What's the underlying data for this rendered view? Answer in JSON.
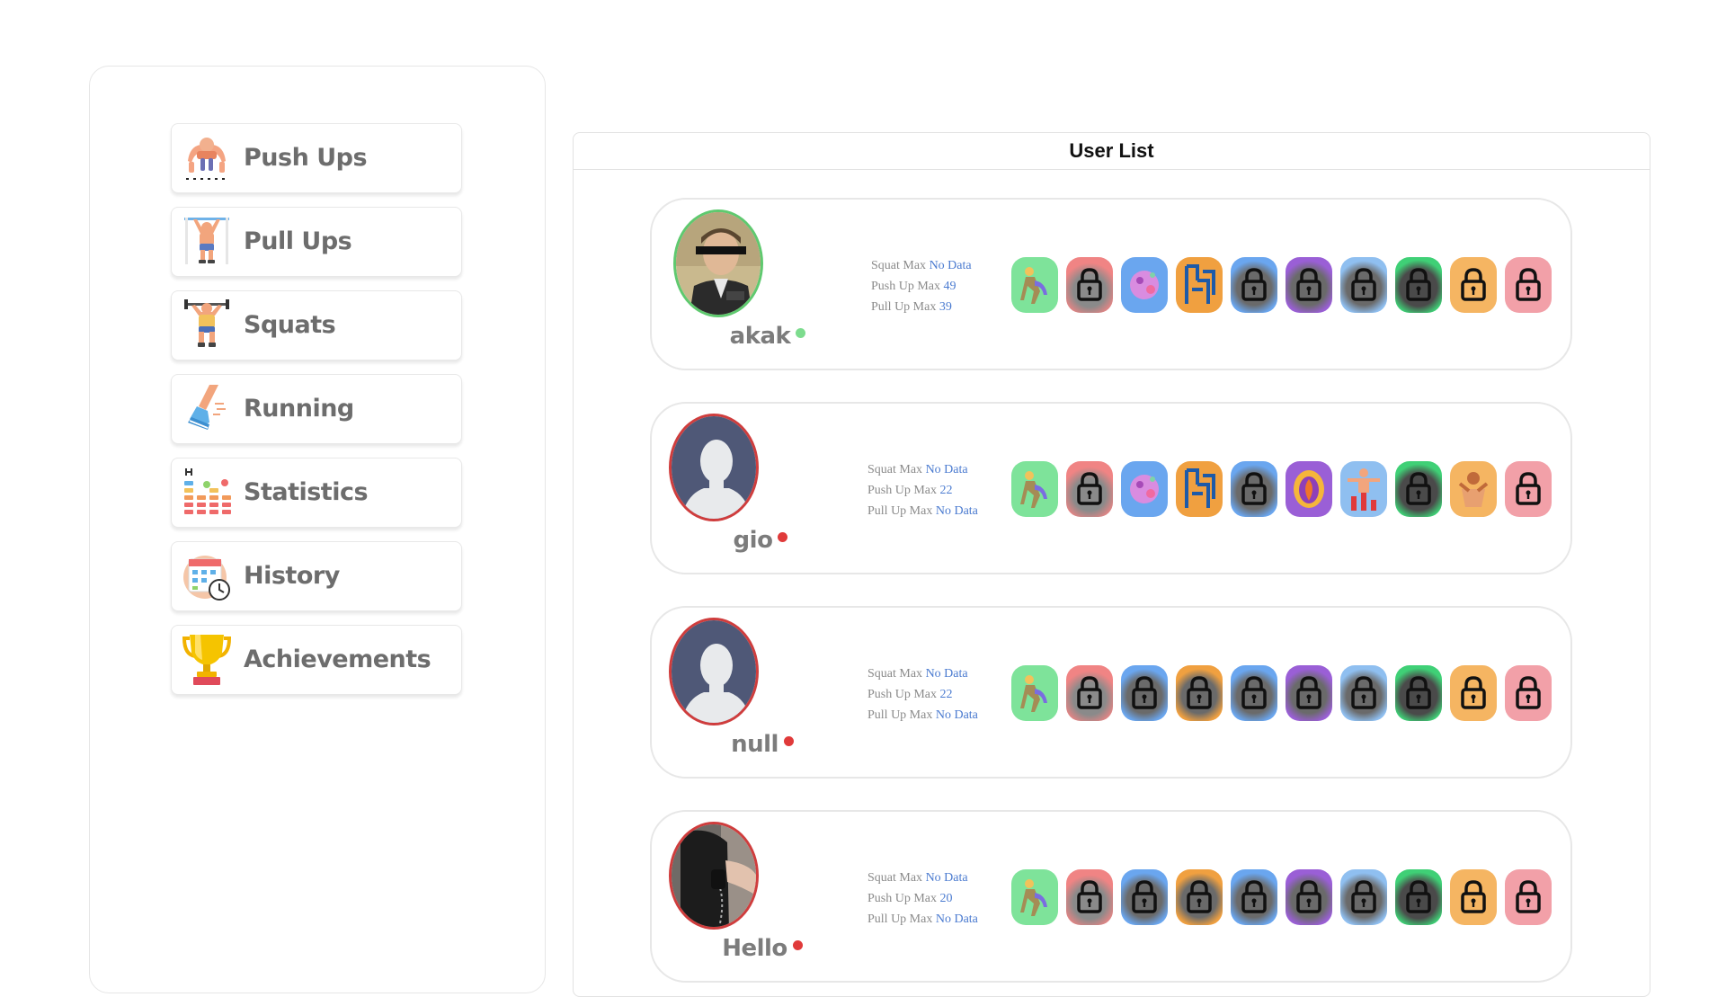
{
  "nav": {
    "items": [
      {
        "label": "Push Ups",
        "icon": "push-ups-icon"
      },
      {
        "label": "Pull Ups",
        "icon": "pull-ups-icon"
      },
      {
        "label": "Squats",
        "icon": "squats-icon"
      },
      {
        "label": "Running",
        "icon": "running-icon"
      },
      {
        "label": "Statistics",
        "icon": "statistics-icon"
      },
      {
        "label": "History",
        "icon": "history-icon"
      },
      {
        "label": "Achievements",
        "icon": "achievements-icon"
      }
    ]
  },
  "user_list": {
    "title": "User List",
    "stat_labels": {
      "squat": "Squat Max",
      "push": "Push Up Max",
      "pull": "Pull Up Max"
    },
    "users": [
      {
        "name": "akak",
        "status": "online",
        "avatar": "photo-portrait-avatar",
        "squat_max": "No Data",
        "push_max": "49",
        "pull_max": "39",
        "badges": [
          "unlocked",
          "locked",
          "unlocked",
          "unlocked",
          "locked",
          "locked",
          "locked",
          "locked",
          "locked",
          "locked"
        ]
      },
      {
        "name": "gio",
        "status": "offline",
        "avatar": "default-silhouette-avatar",
        "squat_max": "No Data",
        "push_max": "22",
        "pull_max": "No Data",
        "badges": [
          "unlocked",
          "locked",
          "unlocked",
          "unlocked",
          "locked",
          "unlocked",
          "unlocked",
          "locked",
          "unlocked",
          "locked"
        ]
      },
      {
        "name": "null",
        "status": "offline",
        "avatar": "default-silhouette-avatar",
        "squat_max": "No Data",
        "push_max": "22",
        "pull_max": "No Data",
        "badges": [
          "unlocked",
          "locked",
          "locked",
          "locked",
          "locked",
          "locked",
          "locked",
          "locked",
          "locked",
          "locked"
        ]
      },
      {
        "name": "Hello",
        "status": "offline",
        "avatar": "photo-phone-avatar",
        "squat_max": "No Data",
        "push_max": "20",
        "pull_max": "No Data",
        "badges": [
          "unlocked",
          "locked",
          "locked",
          "locked",
          "locked",
          "locked",
          "locked",
          "locked",
          "locked",
          "locked"
        ]
      }
    ]
  },
  "colors": {
    "online": "#7ddc8e",
    "offline": "#e03a3a",
    "stat_value": "#4b7bd0",
    "badge_bg": [
      "#7ee39a",
      "#f08484",
      "#6aa6ef",
      "#f0a040",
      "#6aa6ef",
      "#9a5fd6",
      "#8fbff0",
      "#3fd076",
      "#f5b562",
      "#f2a0a8"
    ]
  }
}
